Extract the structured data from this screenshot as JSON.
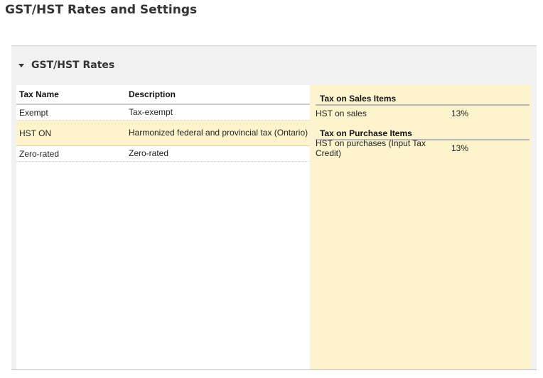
{
  "page": {
    "title": "GST/HST Rates and Settings"
  },
  "panel": {
    "title": "GST/HST Rates"
  },
  "tax_list": {
    "columns": [
      "Tax Name",
      "Description"
    ],
    "rows": [
      {
        "name": "Exempt",
        "description": "Tax-exempt"
      },
      {
        "name": "HST ON",
        "description": "Harmonized federal and provincial tax (Ontario)"
      },
      {
        "name": "Zero-rated",
        "description": "Zero-rated"
      }
    ]
  },
  "details": {
    "sales": {
      "heading": "Tax on Sales Items",
      "items": [
        {
          "label": "HST on sales",
          "rate": "13%"
        }
      ]
    },
    "purchase": {
      "heading": "Tax on Purchase Items",
      "items": [
        {
          "label": "HST on purchases (Input Tax Credit)",
          "rate": "13%"
        }
      ]
    }
  },
  "colors": {
    "highlight": "#fdf4cd",
    "panel_bg": "#f1f1f1"
  },
  "icons": {
    "collapse": "caret-down-icon"
  }
}
